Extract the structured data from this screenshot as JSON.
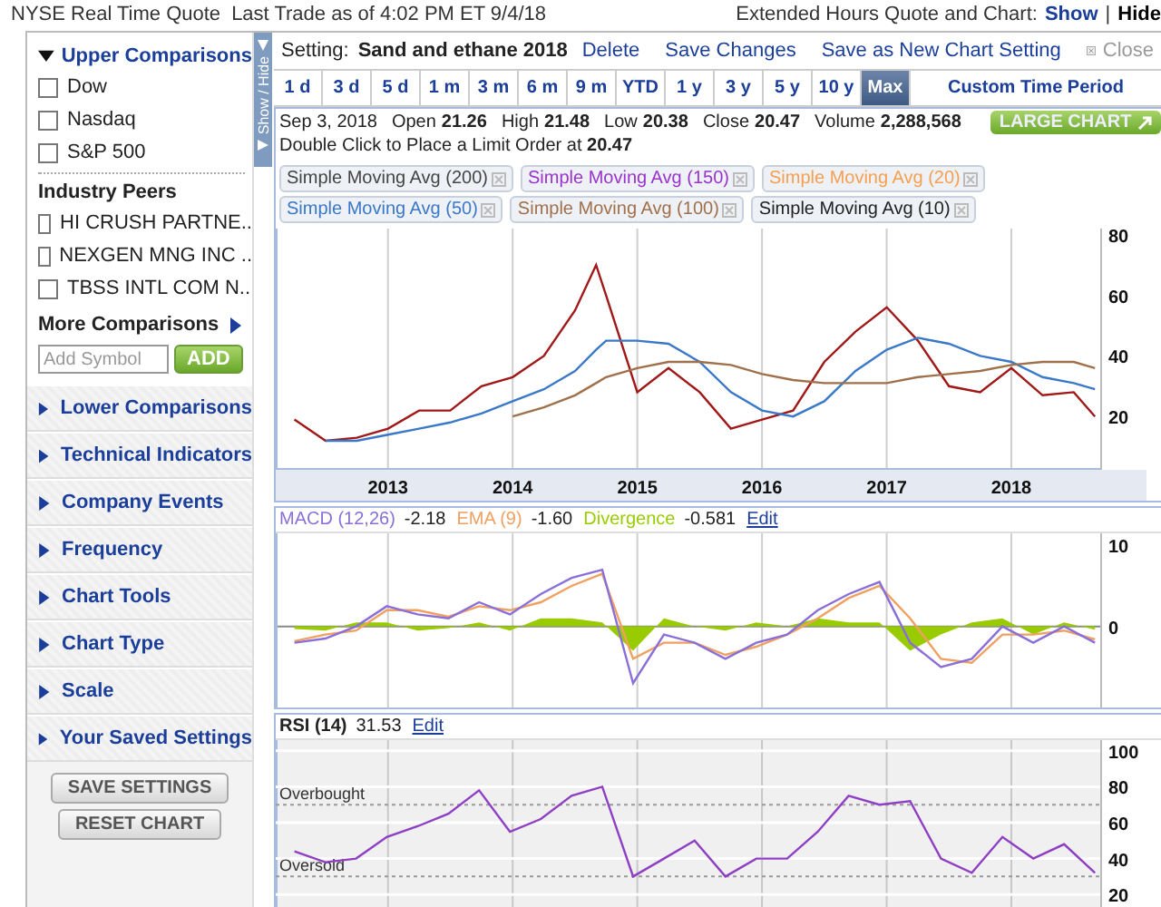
{
  "header": {
    "quote_label": "NYSE Real Time Quote",
    "last_trade": "Last Trade as of 4:02 PM ET 9/4/18",
    "extended_label": "Extended Hours Quote and Chart:",
    "show": "Show",
    "separator": "|",
    "hide": "Hide"
  },
  "sidebar": {
    "upper": {
      "title": "Upper Comparisons",
      "expanded": true,
      "indices": [
        {
          "label": "Dow",
          "checked": false
        },
        {
          "label": "Nasdaq",
          "checked": false
        },
        {
          "label": "S&P 500",
          "checked": false
        }
      ],
      "peers_title": "Industry Peers",
      "peers": [
        {
          "label": "HI CRUSH PARTNE..",
          "checked": false
        },
        {
          "label": "NEXGEN MNG INC ..",
          "checked": false
        },
        {
          "label": "TBSS INTL COM N..",
          "checked": false
        }
      ],
      "more": "More Comparisons",
      "symbol_field": {
        "placeholder": "Add Symbol"
      },
      "add_button": "ADD"
    },
    "sections": [
      {
        "label": "Lower Comparisons",
        "expanded": false
      },
      {
        "label": "Technical Indicators",
        "expanded": false
      },
      {
        "label": "Company Events",
        "expanded": false
      },
      {
        "label": "Frequency",
        "expanded": false
      },
      {
        "label": "Chart Tools",
        "expanded": false
      },
      {
        "label": "Chart Type",
        "expanded": false
      },
      {
        "label": "Scale",
        "expanded": false
      },
      {
        "label": "Your Saved Settings",
        "expanded": false
      }
    ],
    "buttons": [
      "SAVE SETTINGS",
      "RESET CHART"
    ]
  },
  "toggle": "Show / Hide",
  "setting": {
    "label": "Setting:",
    "name": "Sand and ethane 2018",
    "actions": [
      "Delete",
      "Save Changes",
      "Save as New Chart Setting"
    ],
    "close": "Close"
  },
  "periods": [
    {
      "label": "1 d",
      "selected": false
    },
    {
      "label": "3 d",
      "selected": false
    },
    {
      "label": "5 d",
      "selected": false
    },
    {
      "label": "1 m",
      "selected": false
    },
    {
      "label": "3 m",
      "selected": false
    },
    {
      "label": "6 m",
      "selected": false
    },
    {
      "label": "9 m",
      "selected": false
    },
    {
      "label": "YTD",
      "selected": false
    },
    {
      "label": "1 y",
      "selected": false
    },
    {
      "label": "3 y",
      "selected": false
    },
    {
      "label": "5 y",
      "selected": false
    },
    {
      "label": "10 y",
      "selected": false
    },
    {
      "label": "Max",
      "selected": true
    },
    {
      "label": "Custom Time Period",
      "selected": false
    }
  ],
  "quote": {
    "date": "Sep 3, 2018",
    "stats": [
      {
        "label": "Open",
        "value": "21.26"
      },
      {
        "label": "High",
        "value": "21.48"
      },
      {
        "label": "Low",
        "value": "20.38"
      },
      {
        "label": "Close",
        "value": "20.47"
      },
      {
        "label": "Volume",
        "value": "2,288,568"
      }
    ],
    "large_chart": "LARGE CHART",
    "limit_order": "Double Click to Place a Limit Order at **20.47**"
  },
  "indicators": [
    {
      "label": "Simple Moving Avg (200)",
      "color": "#444444"
    },
    {
      "label": "Simple Moving Avg (150)",
      "color": "#9933cc"
    },
    {
      "label": "Simple Moving Avg (20)",
      "color": "#f5a050"
    },
    {
      "label": "Simple Moving Avg (50)",
      "color": "#3a78c8"
    },
    {
      "label": "Simple Moving Avg (100)",
      "color": "#a0704a"
    },
    {
      "label": "Simple Moving Avg (10)",
      "color": "#222222"
    }
  ],
  "price_panel": {
    "chart_data": {
      "type": "line",
      "grid": true,
      "x": [
        2012.25,
        2012.5,
        2012.75,
        2013,
        2013.25,
        2013.5,
        2013.75,
        2014,
        2014.25,
        2014.5,
        2014.67,
        2014.75,
        2015,
        2015.25,
        2015.5,
        2015.75,
        2016,
        2016.25,
        2016.5,
        2016.75,
        2017,
        2017.25,
        2017.5,
        2017.75,
        2018,
        2018.25,
        2018.5,
        2018.67
      ],
      "series": [
        {
          "color": "#a01818",
          "values": [
            19,
            12,
            13,
            16,
            22,
            22,
            30,
            33,
            40,
            55,
            70,
            60,
            28,
            36,
            28,
            16,
            19,
            22,
            38,
            48,
            56,
            45,
            30,
            28,
            36,
            27,
            28,
            20
          ]
        },
        {
          "color": "#3a78c8",
          "values": [
            null,
            12,
            12,
            14,
            16,
            18,
            21,
            25,
            29,
            35,
            42,
            45,
            45,
            44,
            38,
            28,
            22,
            20,
            25,
            35,
            42,
            46,
            44,
            40,
            38,
            33,
            31,
            29
          ]
        },
        {
          "color": "#a0704a",
          "values": [
            null,
            null,
            null,
            null,
            null,
            null,
            null,
            20,
            23,
            27,
            31,
            33,
            36,
            38,
            38,
            37,
            34,
            32,
            31,
            31,
            31,
            33,
            34,
            35,
            37,
            38,
            38,
            36
          ]
        }
      ],
      "xlim": [
        2012.1,
        2018.72
      ],
      "ylim": [
        3,
        82
      ],
      "xticks": [
        {
          "value": 2013,
          "label": "2013"
        },
        {
          "value": 2014,
          "label": "2014"
        },
        {
          "value": 2015,
          "label": "2015"
        },
        {
          "value": 2016,
          "label": "2016"
        },
        {
          "value": 2017,
          "label": "2017"
        },
        {
          "value": 2018,
          "label": "2018"
        }
      ],
      "yticks": [
        20,
        40,
        60,
        80
      ]
    }
  },
  "macd_panel": {
    "readings": [
      "-2.18",
      "-1.60",
      "-0.581"
    ],
    "edit": "Edit",
    "chart_data": {
      "type": "line",
      "grid": true,
      "series": [
        {
          "name": "MACD (12,26)",
          "color": "#8a6fd8",
          "type": "line",
          "values": [
            -2,
            -1.5,
            0,
            2.5,
            1.5,
            1,
            3,
            1.5,
            4,
            6,
            7,
            -7,
            -1,
            -2,
            -4,
            -2,
            -1,
            2,
            4,
            5.5,
            -2,
            -5,
            -4,
            0,
            -2,
            0,
            -2
          ]
        },
        {
          "name": "EMA (9)",
          "color": "#f0a060",
          "type": "line",
          "values": [
            -1.8,
            -1,
            -0.5,
            2,
            2,
            1.2,
            2.5,
            2,
            3,
            5,
            6.5,
            -4,
            -2,
            -2,
            -3.5,
            -2.5,
            -1,
            1,
            3.5,
            5,
            1,
            -4,
            -4.5,
            -1,
            -1,
            -0.5,
            -1.6
          ]
        },
        {
          "name": "Divergence",
          "color": "#99cc00",
          "type": "area",
          "values": [
            -0.3,
            -0.5,
            0.5,
            0.5,
            -0.5,
            -0.2,
            0.5,
            -0.5,
            1,
            1,
            0.5,
            -3,
            1,
            0,
            -0.5,
            0.5,
            0,
            1,
            0.5,
            0.5,
            -3,
            -1,
            0.5,
            1,
            -1,
            0.5,
            -0.4
          ]
        }
      ],
      "ylim": [
        -10,
        11.5
      ],
      "yticks": [
        0,
        10
      ]
    }
  },
  "rsi_panel": {
    "readings": [
      "31.53"
    ],
    "edit": "Edit",
    "chart_data": {
      "type": "line",
      "grid": true,
      "series": [
        {
          "name": "RSI (14)",
          "color": "#8e3fc4",
          "values": [
            44,
            38,
            40,
            52,
            58,
            65,
            78,
            55,
            62,
            75,
            80,
            30,
            40,
            50,
            30,
            40,
            40,
            55,
            75,
            70,
            72,
            40,
            32,
            52,
            40,
            48,
            32
          ]
        }
      ],
      "ylim": [
        13,
        106
      ],
      "yticks": [
        20,
        40,
        60,
        80,
        100
      ],
      "ref_lines": [
        {
          "axis": "y",
          "value": 70,
          "label": "Overbought"
        },
        {
          "axis": "y",
          "value": 30,
          "label": "Oversold"
        }
      ]
    }
  }
}
